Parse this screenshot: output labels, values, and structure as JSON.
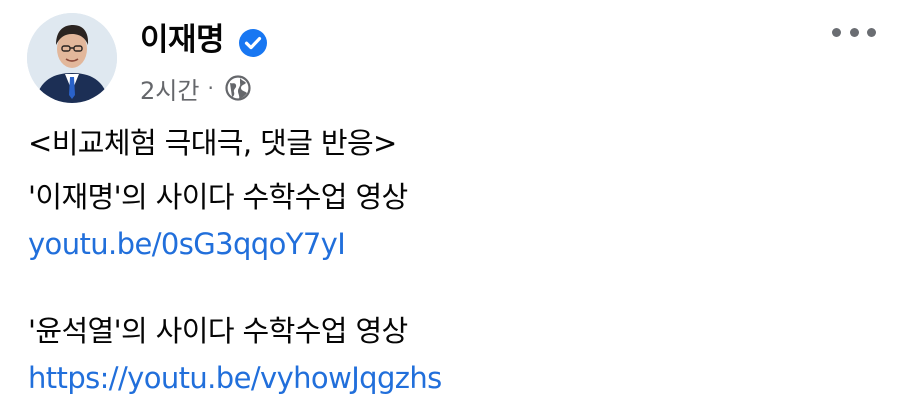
{
  "post": {
    "author": "이재명",
    "verified": true,
    "timestamp": "2시간",
    "separator": "·",
    "audience_icon": "globe-icon",
    "more_icon": "more-options-icon",
    "lines": [
      "<비교체험 극대극, 댓글 반응>",
      "'이재명'의 사이다 수학수업 영상",
      "youtu.be/0sG3qqoY7yI",
      "'윤석열'의 사이다 수학수업  영상",
      "https://youtu.be/vyhowJqgzhs"
    ]
  },
  "colors": {
    "link": "#216fdb",
    "verified_badge": "#1877f2",
    "meta_text": "#65676b"
  }
}
